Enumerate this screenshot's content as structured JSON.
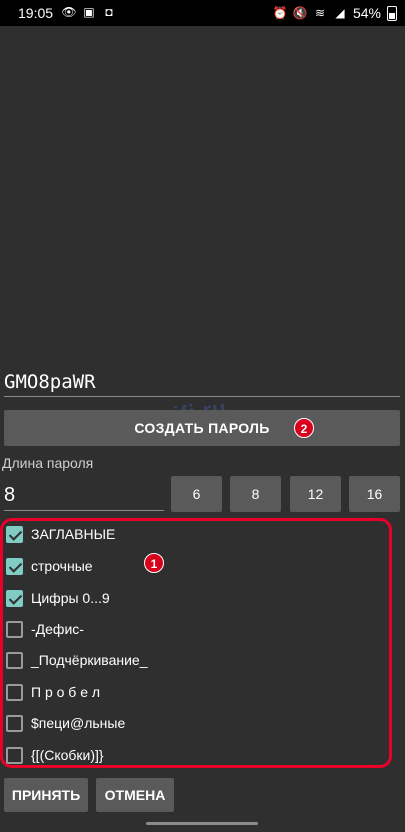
{
  "status_bar": {
    "time": "19:05",
    "battery": "54%",
    "left_icons": [
      "eye-icon",
      "chat-icon",
      "photo-icon"
    ],
    "right_icons": [
      "alarm-icon",
      "mute-icon",
      "wifi-icon",
      "signal-icon",
      "battery-icon"
    ]
  },
  "password": {
    "value": "GMO8paWR"
  },
  "create_button": {
    "label": "СОЗДАТЬ ПАРОЛЬ",
    "badge": "2"
  },
  "length": {
    "label": "Длина пароля",
    "value": "8"
  },
  "presets": [
    "6",
    "8",
    "12",
    "16"
  ],
  "options": {
    "badge": "1",
    "items": [
      {
        "label": "ЗАГЛАВНЫЕ",
        "checked": true
      },
      {
        "label": "строчные",
        "checked": true
      },
      {
        "label": "Цифры 0...9",
        "checked": true
      },
      {
        "label": "-Дефис-",
        "checked": false
      },
      {
        "label": "_Подчёркивание_",
        "checked": false
      },
      {
        "label": "П р о б е л",
        "checked": false
      },
      {
        "label": "$пеци@льные",
        "checked": false
      },
      {
        "label": "{[(Скобки)]}",
        "checked": false
      }
    ]
  },
  "footer": {
    "accept_label": "ПРИНЯТЬ",
    "cancel_label": "ОТМЕНА"
  },
  "watermark": "help-wifi.ru",
  "colors": {
    "accent": "#80cbc4",
    "highlight": "#e8002a",
    "background": "#2f2f2f",
    "button": "#5a5a5a"
  }
}
